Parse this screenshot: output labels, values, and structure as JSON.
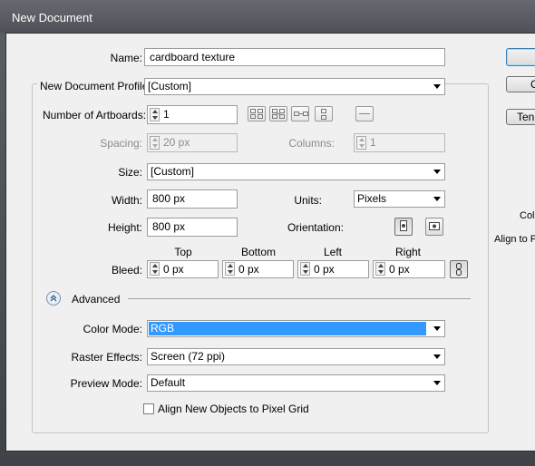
{
  "window": {
    "title": "New Document"
  },
  "name": {
    "label": "Name:",
    "value": "cardboard texture"
  },
  "profile": {
    "label": "New Document Profile:",
    "value": "[Custom]"
  },
  "artboards": {
    "label": "Number of Artboards:",
    "value": "1"
  },
  "spacing": {
    "label": "Spacing:",
    "value": "20 px"
  },
  "columns": {
    "label": "Columns:",
    "value": "1"
  },
  "size": {
    "label": "Size:",
    "value": "[Custom]"
  },
  "width": {
    "label": "Width:",
    "value": "800 px"
  },
  "units": {
    "label": "Units:",
    "value": "Pixels"
  },
  "height": {
    "label": "Height:",
    "value": "800 px"
  },
  "orientation": {
    "label": "Orientation:",
    "selected": "portrait"
  },
  "bleed": {
    "label": "Bleed:",
    "top_label": "Top",
    "bottom_label": "Bottom",
    "left_label": "Left",
    "right_label": "Right",
    "top": "0 px",
    "bottom": "0 px",
    "left": "0 px",
    "right": "0 px"
  },
  "advanced": {
    "label": "Advanced",
    "expanded": true
  },
  "color_mode": {
    "label": "Color Mode:",
    "value": "RGB"
  },
  "raster_effects": {
    "label": "Raster Effects:",
    "value": "Screen (72 ppi)"
  },
  "preview_mode": {
    "label": "Preview Mode:",
    "value": "Default"
  },
  "align_pixel_grid": {
    "label": "Align New Objects to Pixel Grid",
    "checked": false
  },
  "right_panel": {
    "ok_label": "",
    "cancel_label": "C",
    "templates_label": "Ten",
    "info_color": "Colo",
    "info_align": "Align to P"
  },
  "colors": {
    "highlight": "#3399ff",
    "window_title_bg": "#555a60",
    "dialog_bg": "#f0f0f0"
  }
}
